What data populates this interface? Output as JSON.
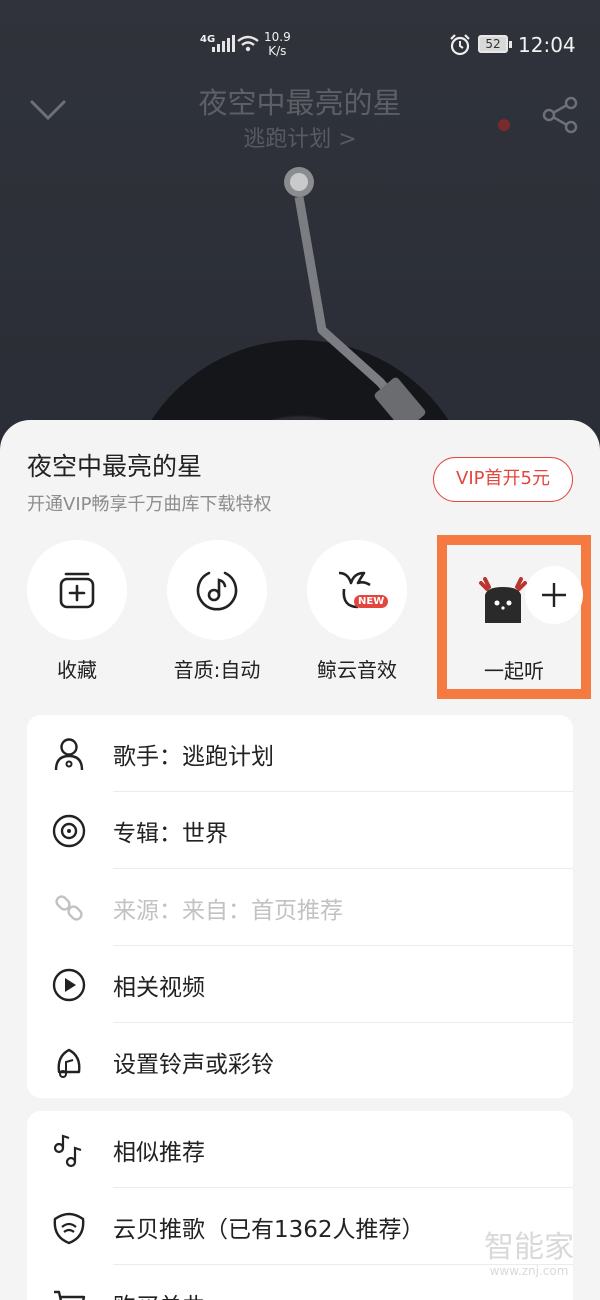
{
  "status_bar": {
    "network": "4G",
    "speed": "10.9",
    "speed_unit": "K/s",
    "battery": "52",
    "time": "12:04"
  },
  "player": {
    "song_title": "夜空中最亮的星",
    "artist_link": "逃跑计划 >"
  },
  "sheet": {
    "title": "夜空中最亮的星",
    "subtitle": "开通VIP畅享千万曲库下载特权",
    "vip_button": "VIP首开5元",
    "actions": [
      {
        "label": "收藏",
        "icon": "add-to-playlist-icon"
      },
      {
        "label": "音质:自动",
        "icon": "music-quality-icon"
      },
      {
        "label": "鲸云音效",
        "icon": "whale-sound-icon",
        "badge": "NEW"
      },
      {
        "label": "一起听",
        "icon": "plus-icon"
      }
    ],
    "menu1": [
      {
        "label": "歌手：逃跑计划",
        "icon": "singer-icon"
      },
      {
        "label": "专辑：世界",
        "icon": "album-icon"
      },
      {
        "label": "来源：来自：首页推荐",
        "icon": "link-icon",
        "disabled": true
      },
      {
        "label": "相关视频",
        "icon": "video-icon"
      },
      {
        "label": "设置铃声或彩铃",
        "icon": "ringtone-icon"
      }
    ],
    "menu2": [
      {
        "label": "相似推荐",
        "icon": "similar-music-icon"
      },
      {
        "label": "云贝推歌（已有1362人推荐）",
        "icon": "cloud-coin-icon"
      },
      {
        "label": "购买单曲",
        "icon": "cart-icon"
      }
    ]
  },
  "watermark": {
    "text": "智能家",
    "url": "www.znj.com"
  },
  "colors": {
    "accent": "#e3463d",
    "highlight_border": "#f47a42",
    "sheet_bg": "#f4f4f4"
  }
}
